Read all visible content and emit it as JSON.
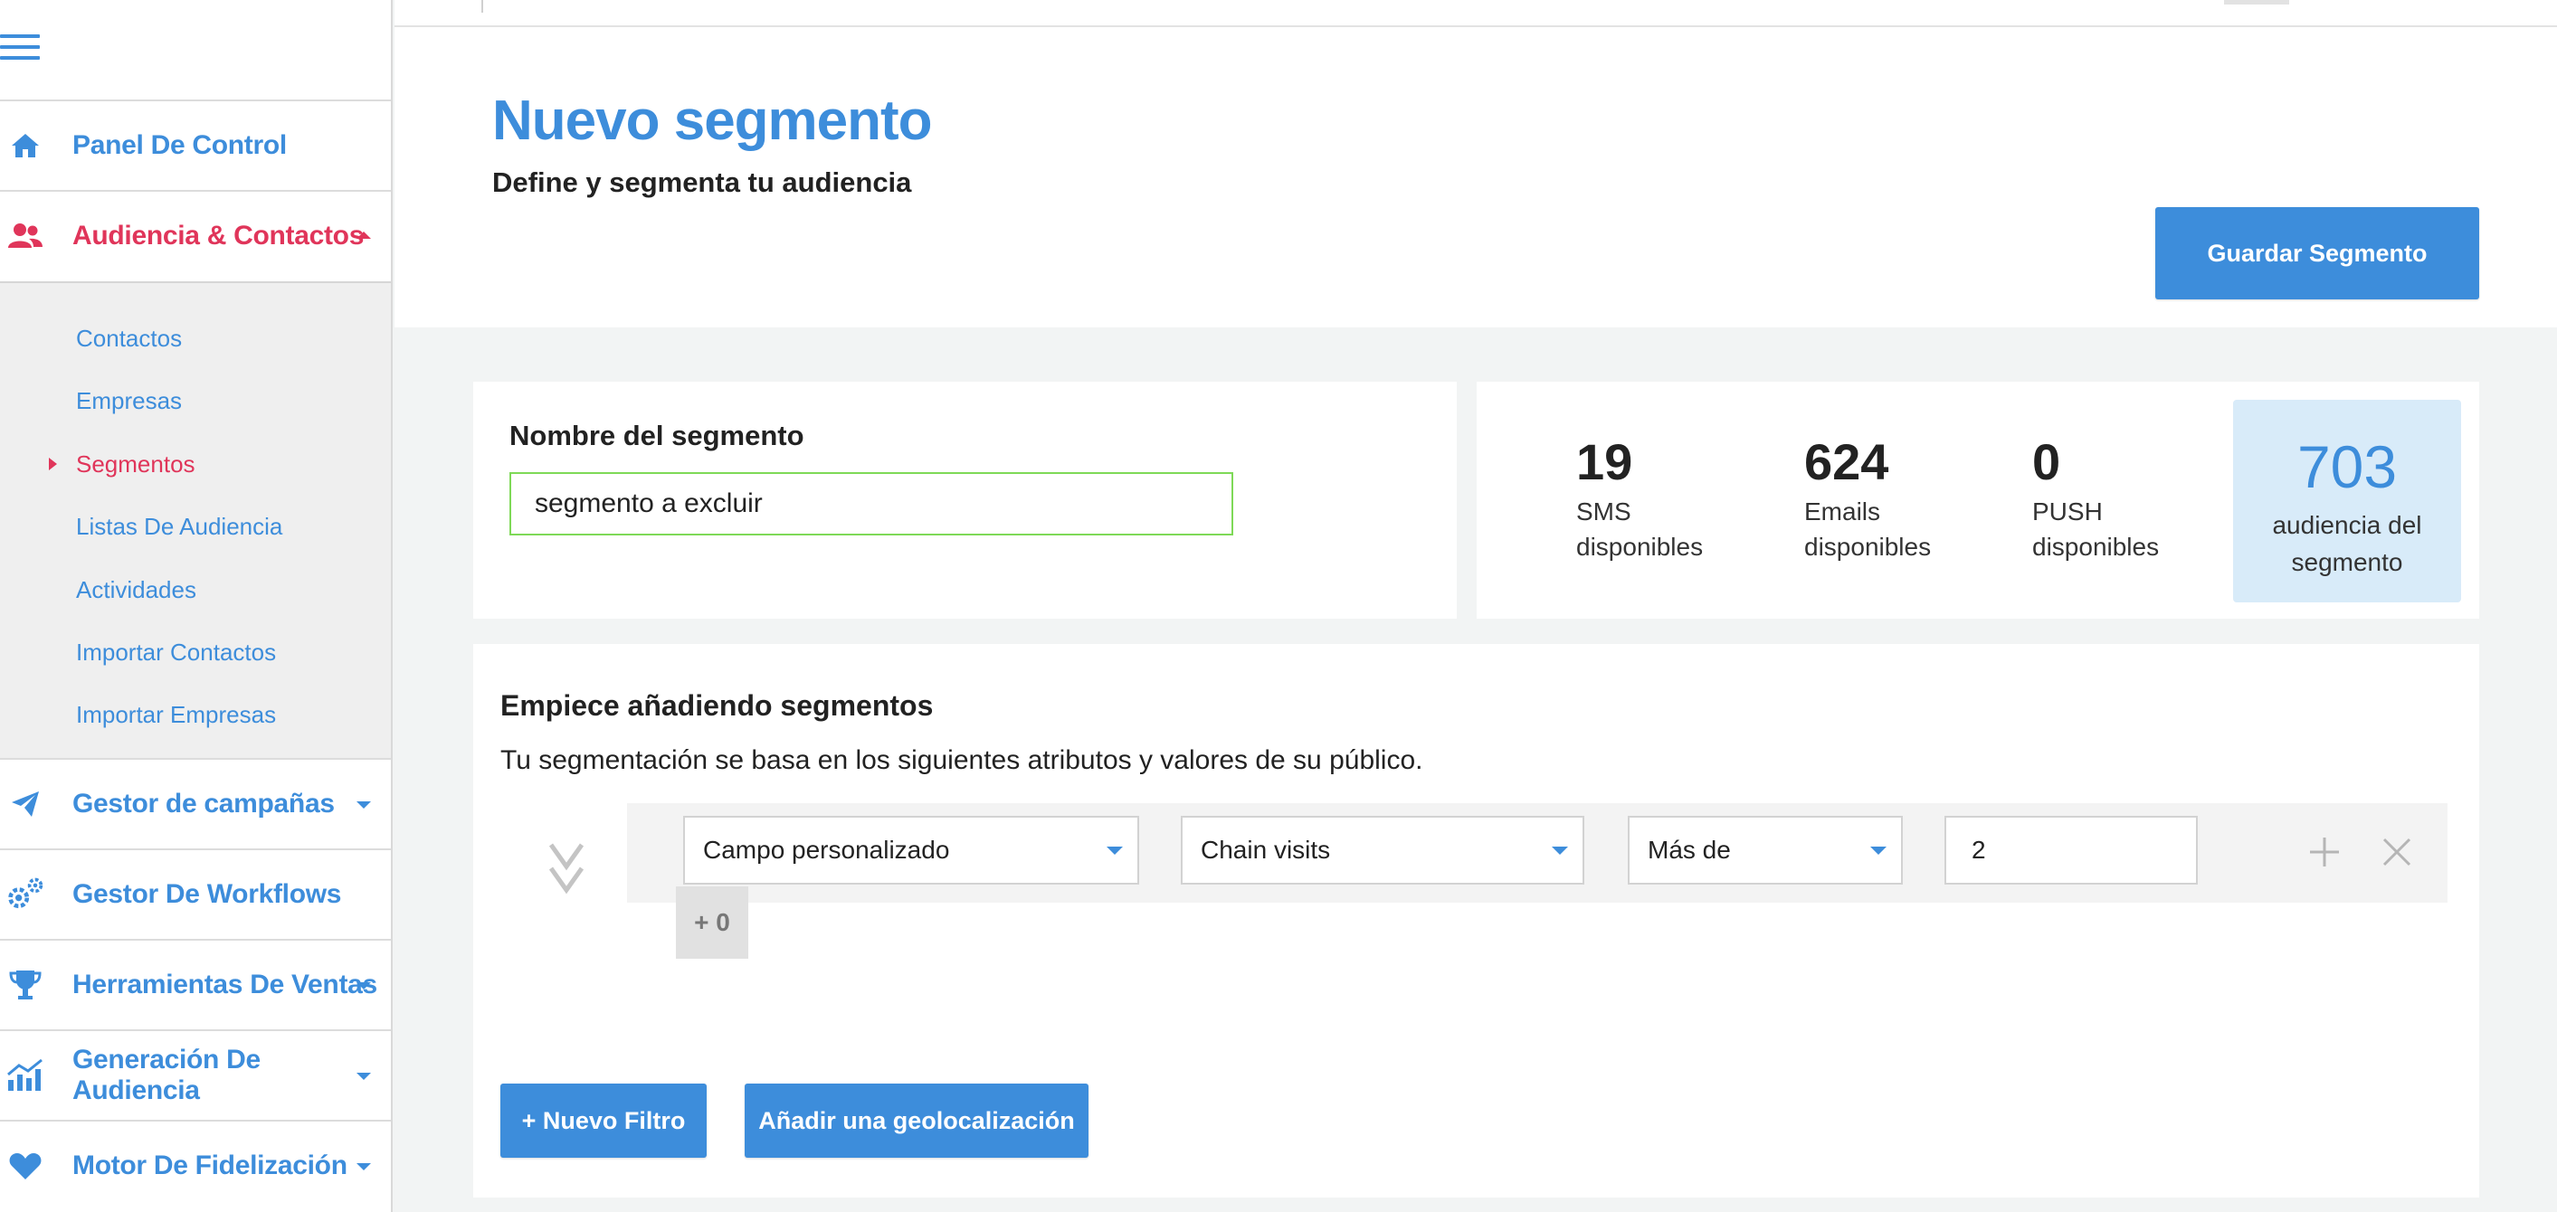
{
  "sidebar": {
    "menu_icon": "hamburger-menu-icon",
    "items": [
      {
        "label": "Panel De Control",
        "icon": "home-icon"
      },
      {
        "label": "Audiencia & Contactos",
        "icon": "users-icon"
      },
      {
        "label": "Gestor de campañas",
        "icon": "paper-plane-icon"
      },
      {
        "label": "Gestor De Workflows",
        "icon": "gears-icon"
      },
      {
        "label": "Herramientas De Ventas",
        "icon": "trophy-icon"
      },
      {
        "label": "Generación De Audiencia",
        "icon": "chart-line-icon"
      },
      {
        "label": "Motor De Fidelización",
        "icon": "heart-icon"
      }
    ],
    "submenu": [
      {
        "label": "Contactos"
      },
      {
        "label": "Empresas"
      },
      {
        "label": "Segmentos"
      },
      {
        "label": "Listas De Audiencia"
      },
      {
        "label": "Actividades"
      },
      {
        "label": "Importar Contactos"
      },
      {
        "label": "Importar Empresas"
      }
    ],
    "active_submenu": "Segmentos"
  },
  "header": {
    "title": "Nuevo segmento",
    "subtitle": "Define y segmenta tu audiencia",
    "save_label": "Guardar Segmento"
  },
  "segment_name": {
    "label": "Nombre del segmento",
    "value": "segmento a excluir"
  },
  "stats": {
    "sms": {
      "value": "19",
      "label_1": "SMS",
      "label_2": "disponibles"
    },
    "emails": {
      "value": "624",
      "label_1": "Emails",
      "label_2": "disponibles"
    },
    "push": {
      "value": "0",
      "label_1": "PUSH",
      "label_2": "disponibles"
    },
    "audience": {
      "value": "703",
      "label_1": "audiencia del",
      "label_2": "segmento"
    }
  },
  "filters": {
    "title": "Empiece añadiendo segmentos",
    "description": "Tu segmentación se basa en los siguientes atributos y valores de su público.",
    "rows": [
      {
        "field": "Campo personalizado",
        "attribute": "Chain visits",
        "operator": "Más de",
        "value": "2"
      }
    ],
    "plus_zero": "+ 0",
    "new_filter_label": "+ Nuevo Filtro",
    "add_geo_label": "Añadir una geolocalización"
  },
  "colors": {
    "primary": "#3d8ddb",
    "active": "#e0355a",
    "valid_border": "#7ed957",
    "audience_bg": "#d8ebf9"
  }
}
